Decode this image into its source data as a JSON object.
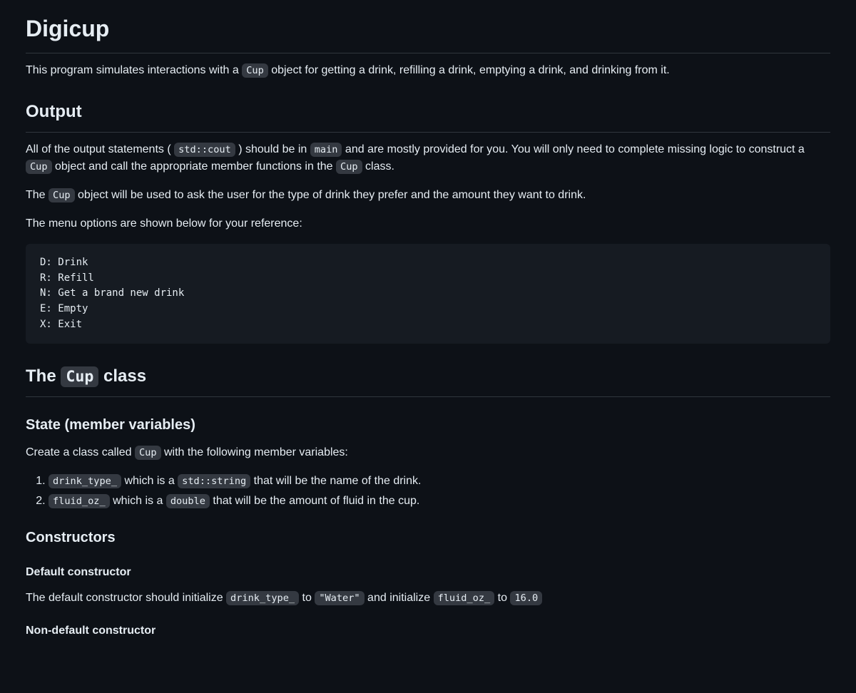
{
  "h1": "Digicup",
  "intro": {
    "pre": "This program simulates interactions with a ",
    "code1": "Cup",
    "post": " object for getting a drink, refilling a drink, emptying a drink, and drinking from it."
  },
  "output": {
    "heading": "Output",
    "p1": {
      "t1": "All of the output statements ( ",
      "c1": "std::cout",
      "t2": " ) should be in ",
      "c2": "main",
      "t3": " and are mostly provided for you. You will only need to complete missing logic to construct a ",
      "c3": "Cup",
      "t4": " object and call the appropriate member functions in the ",
      "c4": "Cup",
      "t5": " class."
    },
    "p2": {
      "t1": "The ",
      "c1": "Cup",
      "t2": " object will be used to ask the user for the type of drink they prefer and the amount they want to drink."
    },
    "p3": "The menu options are shown below for your reference:",
    "menu": "D: Drink\nR: Refill\nN: Get a brand new drink\nE: Empty\nX: Exit"
  },
  "cupclass": {
    "heading_pre": "The ",
    "heading_code": "Cup",
    "heading_post": " class",
    "state_heading": "State (member variables)",
    "state_p": {
      "t1": "Create a class called ",
      "c1": "Cup",
      "t2": " with the following member variables:"
    },
    "vars": [
      {
        "c1": "drink_type_",
        "t1": " which is a ",
        "c2": "std::string",
        "t2": " that will be the name of the drink."
      },
      {
        "c1": "fluid_oz_",
        "t1": " which is a ",
        "c2": "double",
        "t2": " that will be the amount of fluid in the cup."
      }
    ],
    "ctors_heading": "Constructors",
    "default_ctor_heading": "Default constructor",
    "default_ctor_p": {
      "t1": "The default constructor should initialize ",
      "c1": "drink_type_",
      "t2": " to ",
      "c2": "\"Water\"",
      "t3": " and initialize ",
      "c3": "fluid_oz_",
      "t4": " to ",
      "c4": "16.0"
    },
    "nondefault_ctor_heading": "Non-default constructor"
  }
}
